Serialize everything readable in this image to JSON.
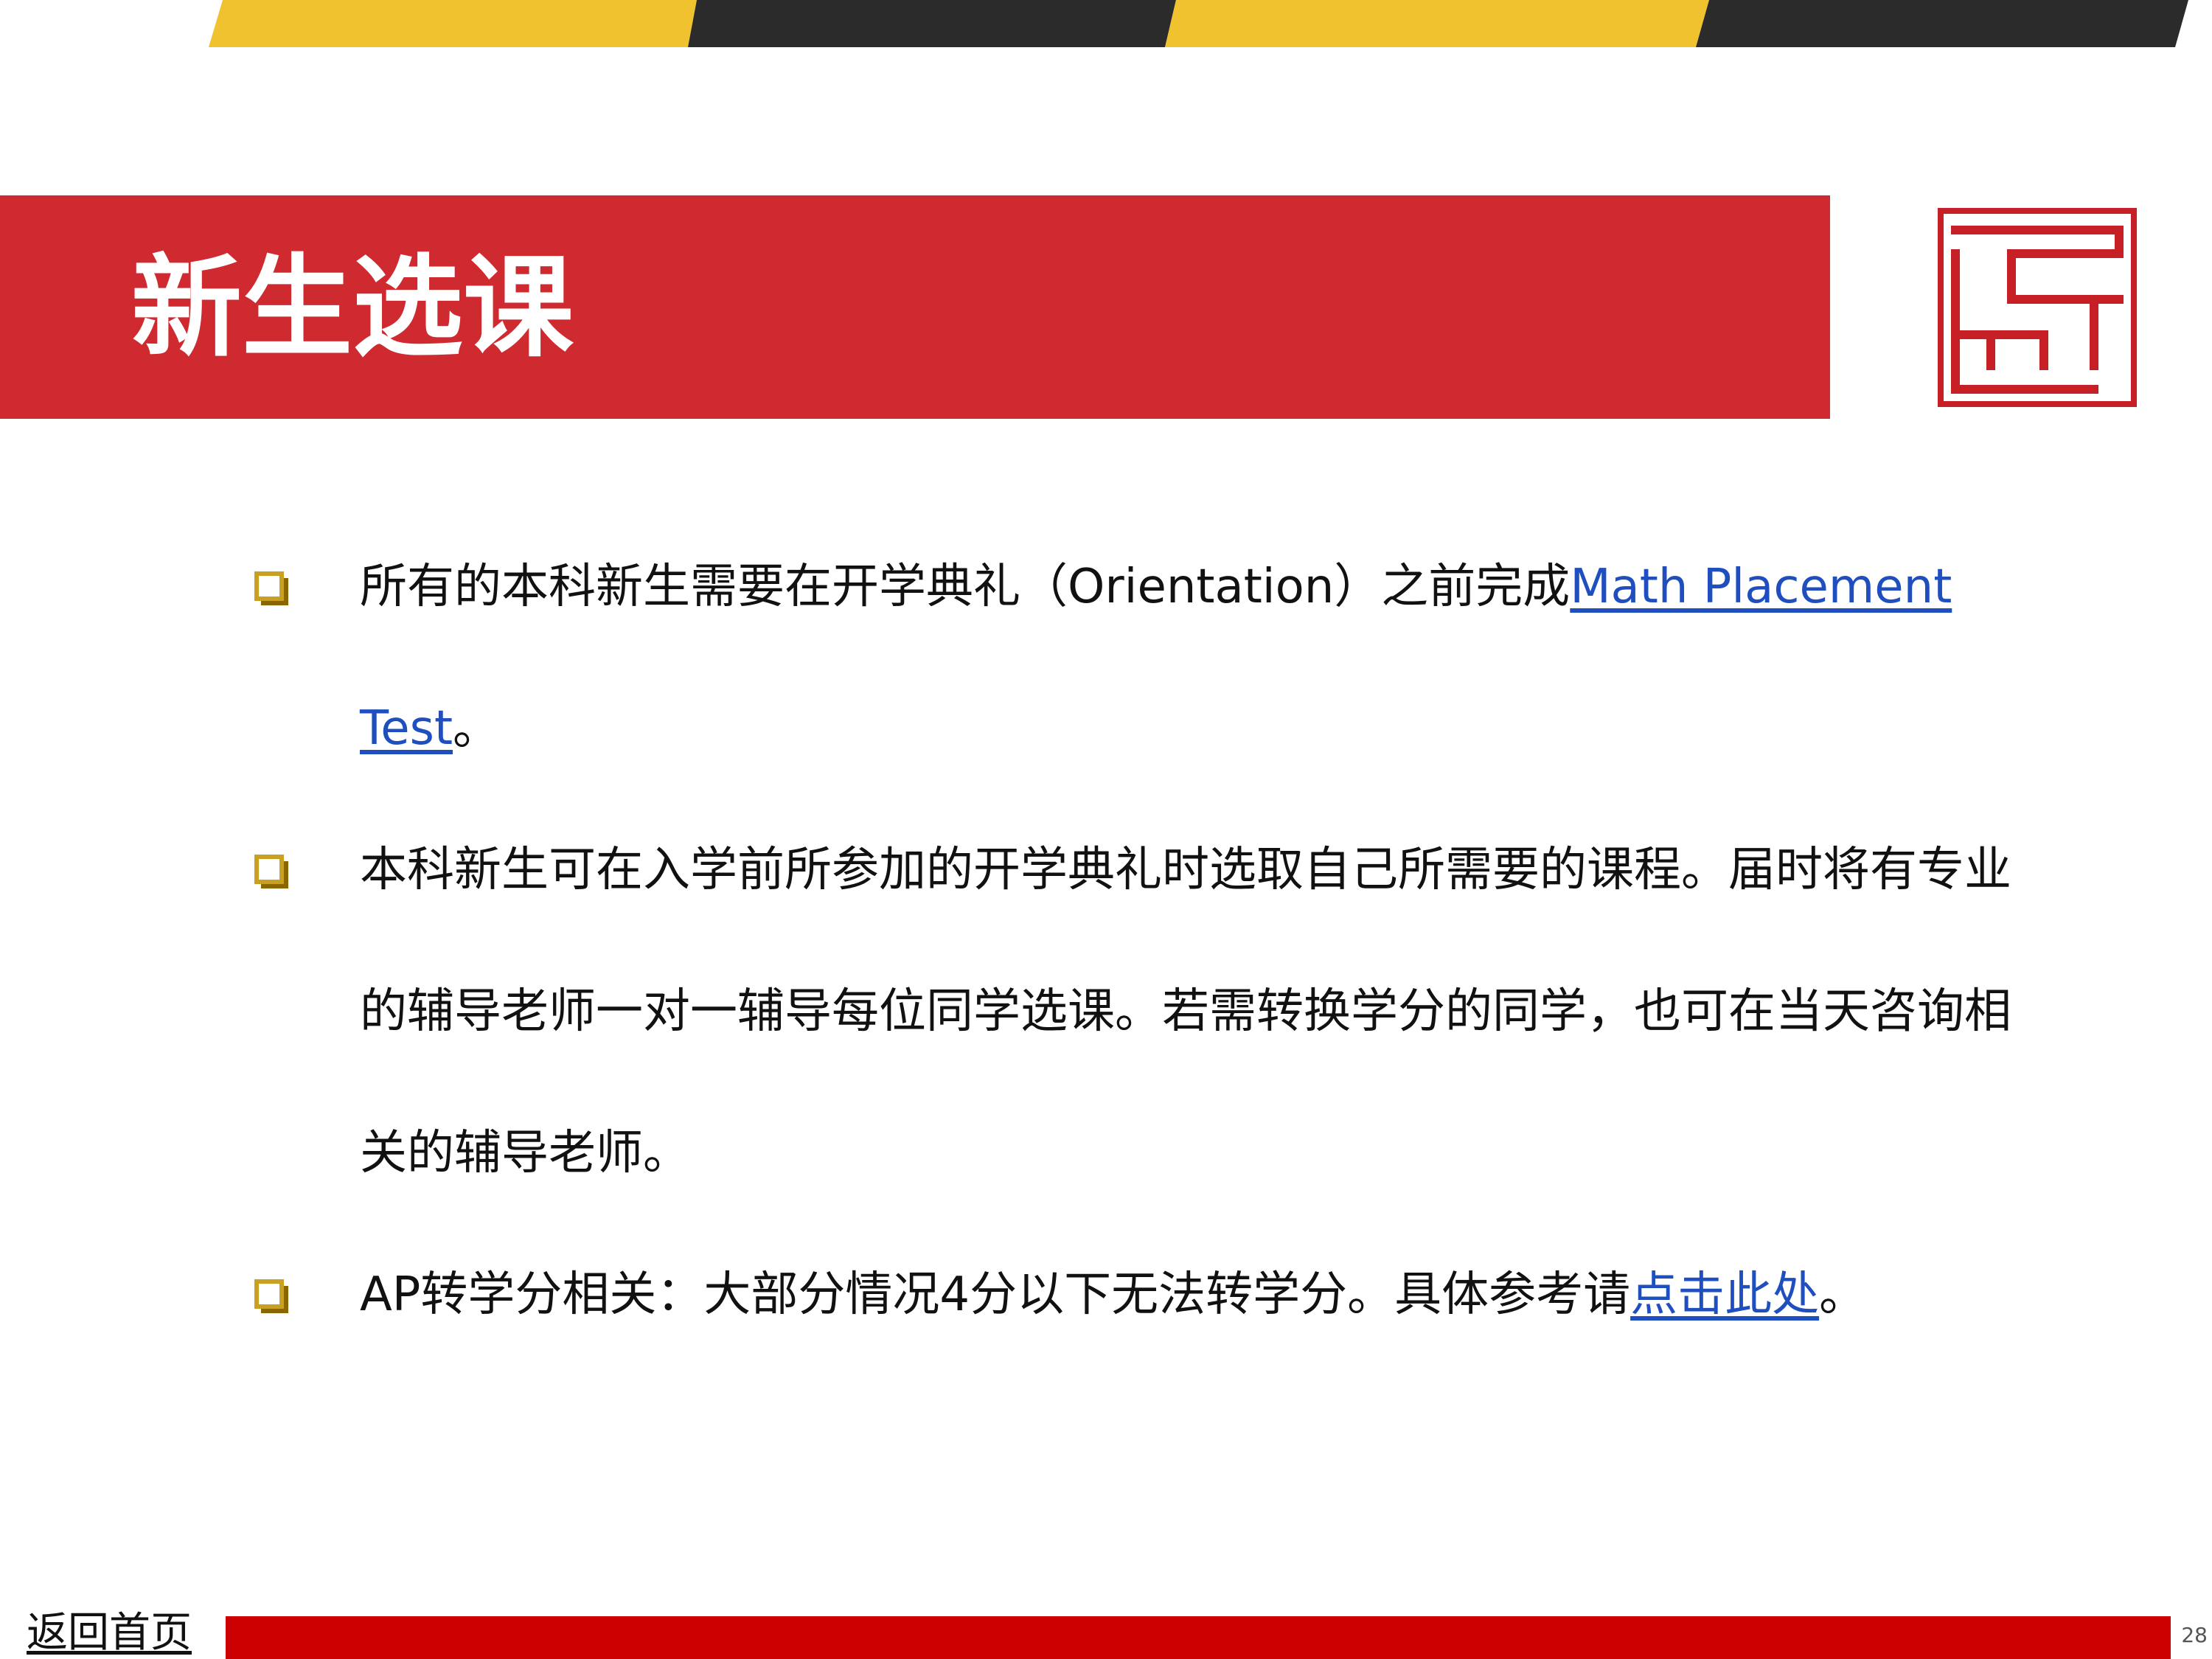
{
  "header": {
    "title": "新生选课"
  },
  "colors": {
    "title_bar": "#cf2a30",
    "top_yellow": "#f0c22f",
    "top_dark": "#2b2b2b",
    "link": "#1f4fbf",
    "bullet_marker": "#c9a01f",
    "footer_bar": "#cc0000"
  },
  "icons": {
    "logo": "red-square-seal-icon",
    "bullet": "square-checkbox-icon"
  },
  "content": {
    "bullets": [
      {
        "text": "所有的本科新生需要在开学典礼（Orientation）之前完成",
        "link": "Math Placement Test",
        "suffix": "。"
      },
      {
        "text": "本科新生可在入学前所参加的开学典礼时选取自己所需要的课程。届时将有专业的辅导老师一对一辅导每位同学选课。若需转换学分的同学，也可在当天咨询相关的辅导老师。"
      },
      {
        "text": "AP转学分相关：大部分情况4分以下无法转学分。具体参考请",
        "link": "点击此处",
        "suffix": "。"
      }
    ]
  },
  "footer": {
    "back_link": "返回首页",
    "page_number": "28"
  }
}
